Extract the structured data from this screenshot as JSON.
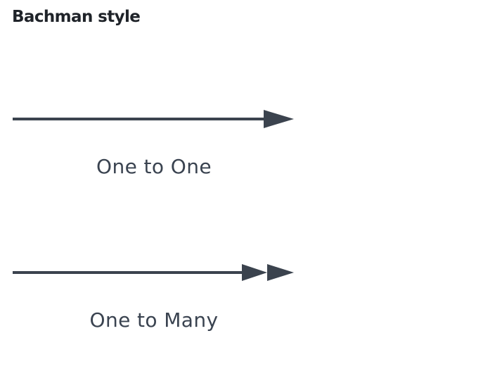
{
  "title": "Bachman style",
  "relationships": [
    {
      "label": "One to One",
      "arrow": "single-arrowhead-icon"
    },
    {
      "label": "One to Many",
      "arrow": "double-arrowhead-icon"
    }
  ],
  "colors": {
    "line": "#3b434e",
    "title": "#1f2329",
    "label": "#3a4350"
  }
}
